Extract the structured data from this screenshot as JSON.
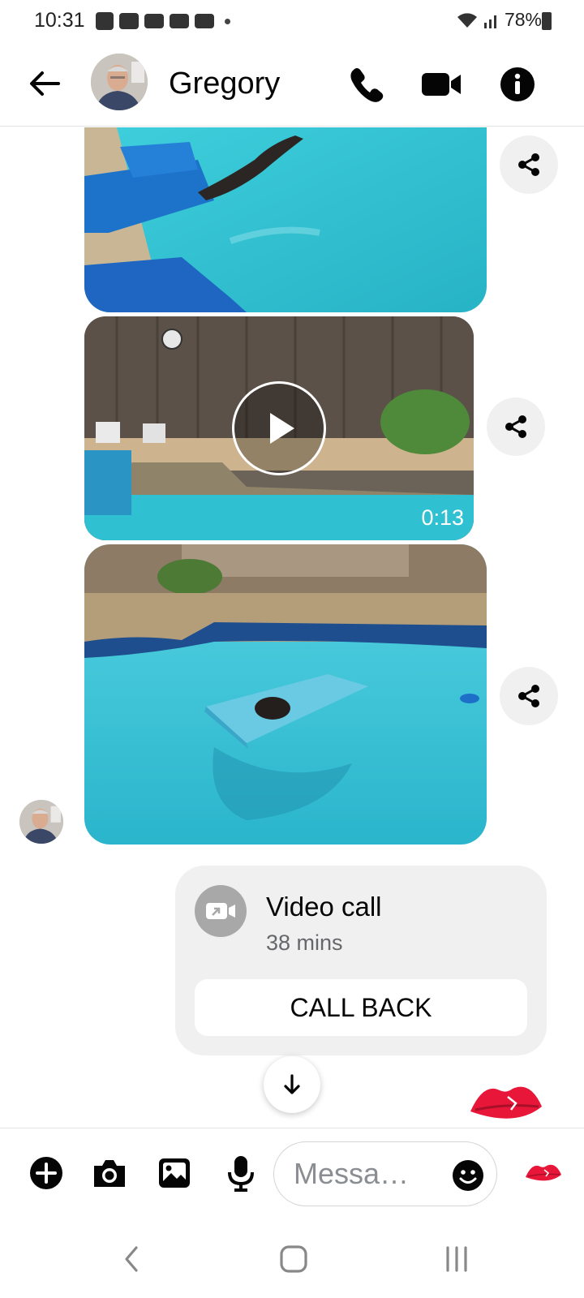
{
  "status_bar": {
    "time": "10:31",
    "battery": "78%",
    "notification_icons": [
      "shopping-icon",
      "folder-icon",
      "youtube-icon",
      "youtube-icon",
      "youtube-icon",
      "dot-icon"
    ]
  },
  "header": {
    "back_icon": "arrow-left-icon",
    "contact_name": "Gregory",
    "actions": [
      "phone-icon",
      "video-camera-icon",
      "info-icon"
    ]
  },
  "messages": {
    "media": [
      {
        "kind": "photo",
        "description": "pool-dog-jump"
      },
      {
        "kind": "video",
        "duration": "0:13"
      },
      {
        "kind": "photo",
        "description": "pool-float-dog"
      }
    ],
    "video_call": {
      "title": "Video call",
      "duration": "38 mins",
      "button_label": "CALL BACK"
    }
  },
  "composer": {
    "placeholder": "Messa…",
    "buttons": [
      "plus-icon",
      "camera-icon",
      "gallery-icon",
      "microphone-icon"
    ],
    "emoji_icon": "emoji-icon",
    "quick_reaction": "kiss-lips-icon"
  },
  "nav_bar": {
    "buttons": [
      "back-icon",
      "home-icon",
      "recents-icon"
    ]
  },
  "colors": {
    "accent": "#e8173a",
    "bubble_gray": "#f0f0f0",
    "pool": "#38c6d8"
  }
}
